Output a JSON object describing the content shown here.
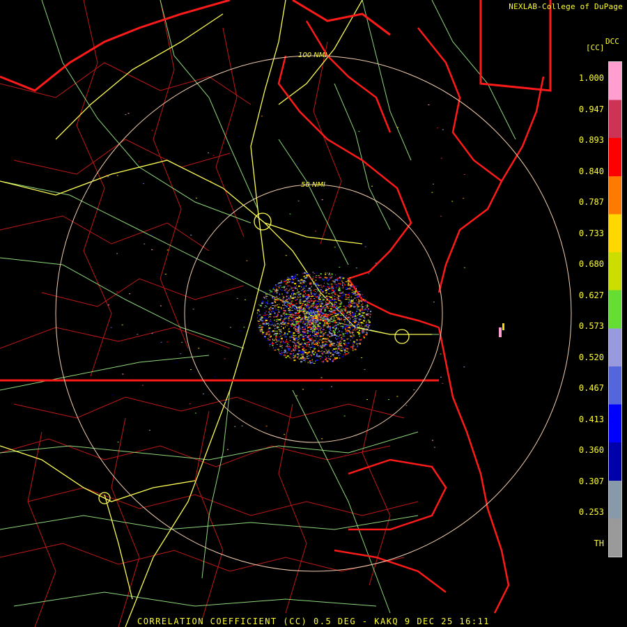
{
  "header": {
    "credit": "NEXLAB-College of DuPage"
  },
  "map": {
    "range_rings": [
      {
        "label": "50 NMI"
      },
      {
        "label": "100 NMI"
      }
    ],
    "colors": {
      "state_borders": "#ff1a1a",
      "county_borders": "#c21818",
      "highways_primary": "#ffff55",
      "highways_secondary": "#a8ff90",
      "range_rings": "#f4d0b0"
    }
  },
  "colorbar": {
    "product": "DCC",
    "unit": "[CC]",
    "ticks": [
      "1.000",
      "0.947",
      "0.893",
      "0.840",
      "0.787",
      "0.733",
      "0.680",
      "0.627",
      "0.573",
      "0.520",
      "0.467",
      "0.413",
      "0.360",
      "0.307",
      "0.253",
      "TH"
    ],
    "colors": [
      "#ff9ecf",
      "#cc3355",
      "#ff0000",
      "#ff7a00",
      "#ffd800",
      "#ccdd00",
      "#66dd33",
      "#9999dd",
      "#5566dd",
      "#0000ff",
      "#0000aa",
      "#8899aa",
      "#9a9a9a"
    ]
  },
  "footer": {
    "caption": "CORRELATION COEFFICIENT (CC) 0.5 DEG - KAKQ 9 DEC 25 16:11"
  }
}
